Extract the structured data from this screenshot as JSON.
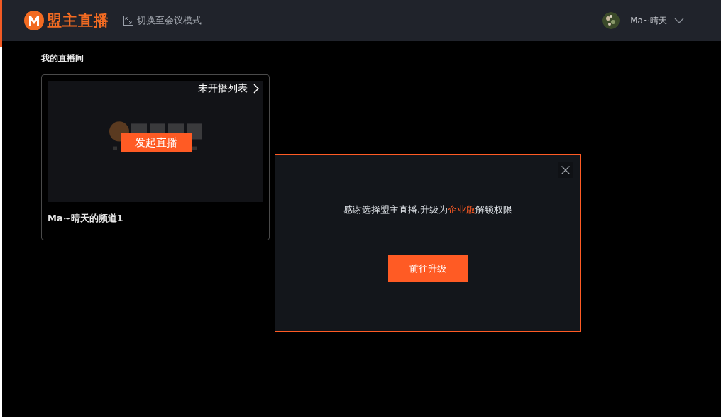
{
  "header": {
    "logo_text": "盟主直播",
    "mode_switch": "切换至会议模式",
    "user_name": "Ma~晴天"
  },
  "section_title": "我的直播间",
  "rooms": [
    {
      "list_link": "未开播列表",
      "start_button": "发起直播",
      "name": "Ma~晴天的频道1"
    }
  ],
  "dialog": {
    "message": [
      {
        "text": "感谢选择盟主直播,升级为",
        "highlight": false
      },
      {
        "text": "企业版",
        "highlight": true
      },
      {
        "text": "解锁权限",
        "highlight": false
      }
    ],
    "button": "前往升级"
  }
}
